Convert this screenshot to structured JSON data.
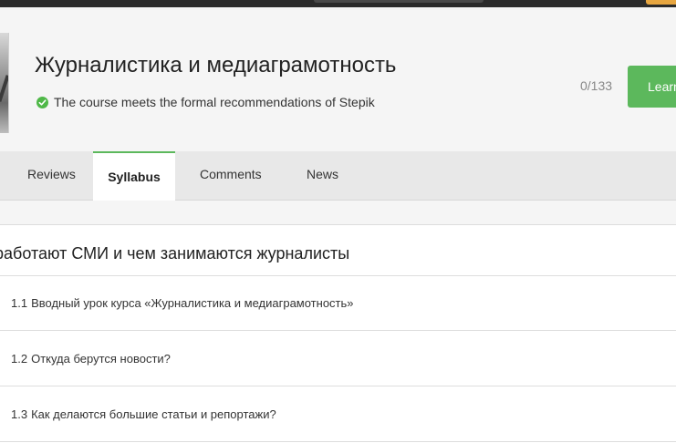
{
  "course": {
    "title": "Журналистика и медиаграмотность",
    "recommendation": "The course meets the formal recommendations of Stepik",
    "progress": "0/133",
    "learn_label": "Learn"
  },
  "tabs": [
    {
      "label": "Reviews",
      "active": false
    },
    {
      "label": "Syllabus",
      "active": true
    },
    {
      "label": "Comments",
      "active": false
    },
    {
      "label": "News",
      "active": false
    }
  ],
  "syllabus": {
    "module_title": "работают СМИ и чем занимаются журналисты",
    "lessons": [
      {
        "number": "1.1",
        "title": "Вводный урок курса «Журналистика и медиаграмотность»"
      },
      {
        "number": "1.2",
        "title": "Откуда берутся новости?"
      },
      {
        "number": "1.3",
        "title": "Как делаются большие статьи и репортажи?"
      }
    ]
  },
  "colors": {
    "accent": "#5cb85c",
    "check": "#4fb848",
    "topbar": "#2b2b2b",
    "header_bg": "#f5f5f5",
    "tabs_bg": "#e8e8e8"
  },
  "icons": {
    "recommendation": "check-circle-icon"
  }
}
